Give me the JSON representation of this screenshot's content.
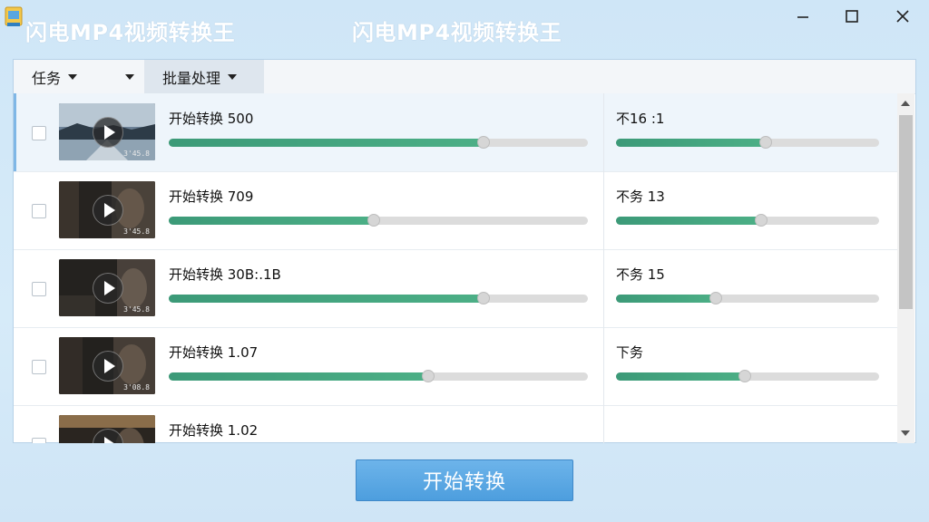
{
  "window": {
    "title_left": "闪电MP4视频转换王",
    "title_center": "闪电MP4视频转换王",
    "icons": [
      "app-icon",
      "minimize-icon",
      "maximize-icon",
      "close-icon"
    ]
  },
  "toolbar": {
    "task_label": "任务",
    "batch_label": "批量处理"
  },
  "rows": [
    {
      "name": "开始转换 500",
      "status": "不16 :1",
      "progress": 0.75,
      "status_progress": 0.57,
      "duration": "3'45.8",
      "selected": true
    },
    {
      "name": "开始转换 709",
      "status": "不务 13",
      "progress": 0.49,
      "status_progress": 0.55,
      "duration": "3'45.8",
      "selected": false
    },
    {
      "name": "开始转换 30B:.1B",
      "status": "不务 15",
      "progress": 0.75,
      "status_progress": 0.38,
      "duration": "3'45.8",
      "selected": false
    },
    {
      "name": "开始转换 1.07",
      "status": "下务",
      "progress": 0.62,
      "status_progress": 0.49,
      "duration": "3'08.8",
      "selected": false
    },
    {
      "name": "开始转换 1.02",
      "status": "",
      "progress": null,
      "status_progress": null,
      "duration": "",
      "selected": false
    }
  ],
  "start_button": "开始转换",
  "colors": {
    "accent": "#4d9ede",
    "progress": "#45a67f",
    "background": "#d2e8f8"
  }
}
